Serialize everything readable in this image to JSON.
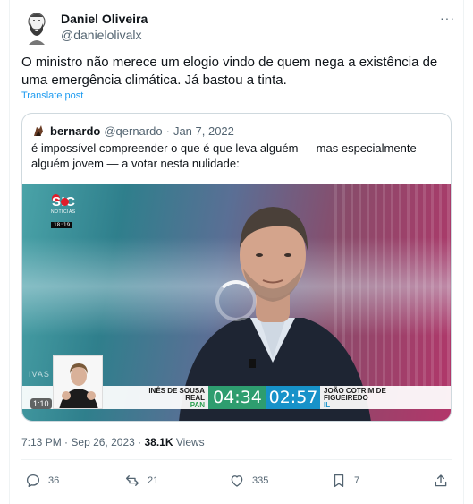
{
  "author": {
    "name": "Daniel Oliveira",
    "handle": "@danielolivalx",
    "more_icon": "more-icon"
  },
  "post": {
    "text": "O ministro não merece um elogio vindo de quem nega a existência de uma emergência climática. Já bastou a tinta.",
    "translate_label": "Translate post"
  },
  "quote": {
    "name": "bernardo",
    "handle": "@qernardo",
    "separator": "·",
    "date": "Jan 7, 2022",
    "text": "é impossível compreender o que é que leva alguém — mas especialmente alguém jovem — a votar nesta nulidade:",
    "video": {
      "channel": "SIC",
      "channel_sub": "NOTÍCIAS",
      "clock": "18:19",
      "side_text": "IVAS",
      "left_candidate": "INÊS DE SOUSA REAL",
      "left_party": "PAN",
      "left_time": "04:34",
      "right_time": "02:57",
      "right_candidate": "JOÃO COTRIM DE FIGUEIREDO",
      "right_party": "IL",
      "duration": "1:10"
    }
  },
  "meta": {
    "time": "7:13 PM",
    "separator": "·",
    "date": "Sep 26, 2023",
    "views_count": "38.1K",
    "views_label": "Views"
  },
  "actions": {
    "replies": "36",
    "reposts": "21",
    "likes": "335",
    "bookmarks": "7"
  },
  "colors": {
    "accent": "#1d9bf0",
    "text": "#0f1419",
    "muted": "#536471",
    "timer_left": "#2e9d6f",
    "timer_right": "#1792c9"
  }
}
